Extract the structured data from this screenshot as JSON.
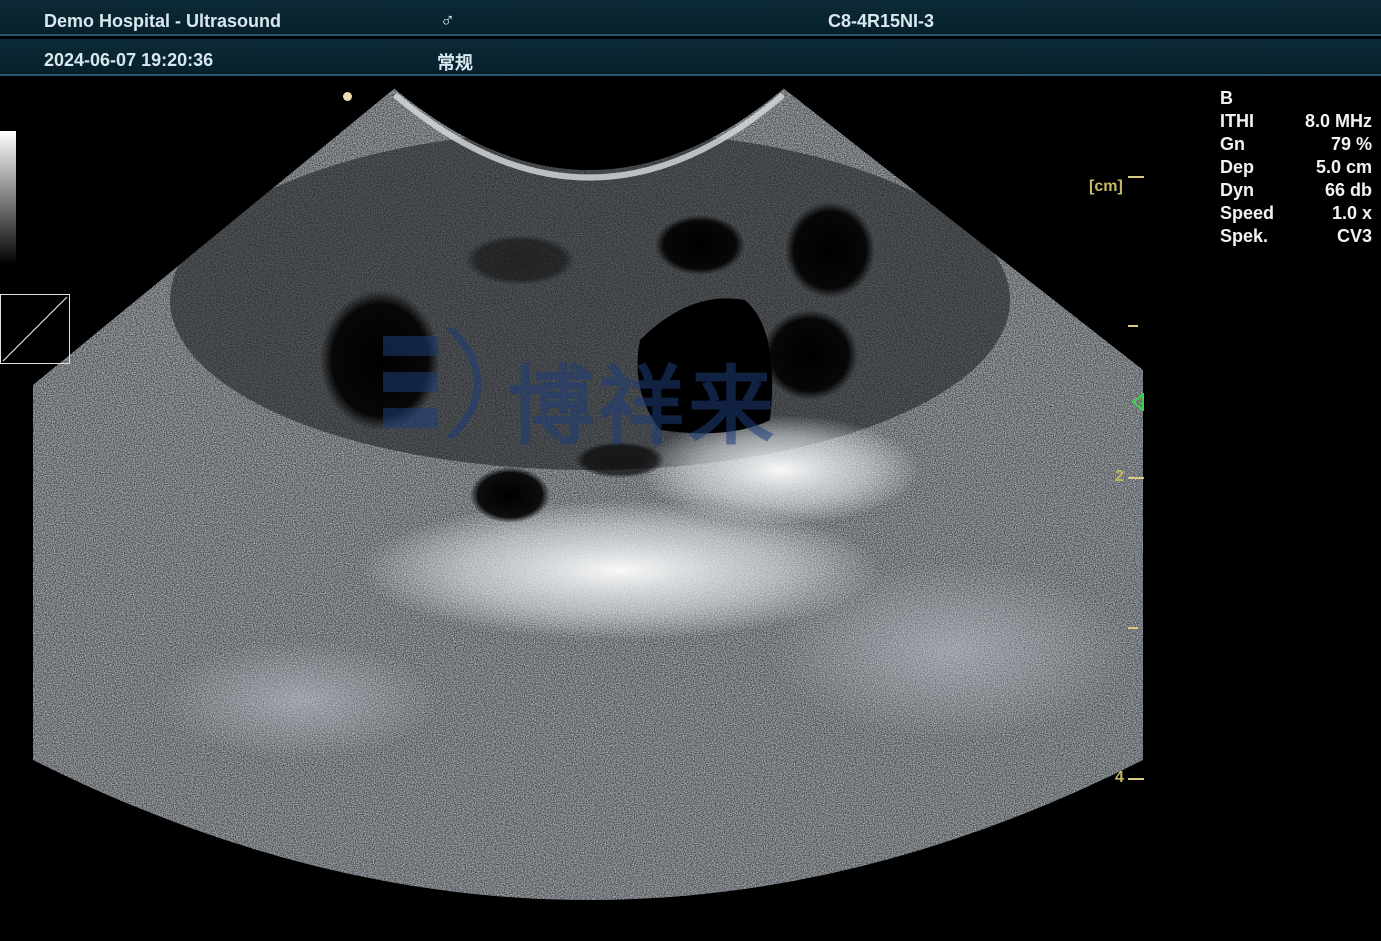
{
  "header": {
    "hospital_title": "Demo Hospital - Ultrasound",
    "gender_symbol": "♂",
    "probe_name": "C8-4R15NI-3",
    "datetime": "2024-06-07 19:20:36",
    "exam_preset": "常规"
  },
  "imaging_params": {
    "mode": "B",
    "rows": [
      {
        "key": "ITHI",
        "value": "8.0 MHz"
      },
      {
        "key": "Gn",
        "value": "79 %"
      },
      {
        "key": "Dep",
        "value": "5.0 cm"
      },
      {
        "key": "Dyn",
        "value": "66 db"
      },
      {
        "key": "Speed",
        "value": "1.0 x"
      },
      {
        "key": "Spek.",
        "value": "CV3"
      }
    ]
  },
  "depth_scale": {
    "unit_label": "[cm]",
    "labels": [
      "2",
      "4"
    ]
  },
  "watermark": {
    "text": "博祥来"
  },
  "colors": {
    "header_bg": "#0c2a36",
    "header_text": "#d8e8ee",
    "scale_color": "#c8b864",
    "focus_marker": "#3cd24a",
    "watermark": "#1e3c78"
  }
}
